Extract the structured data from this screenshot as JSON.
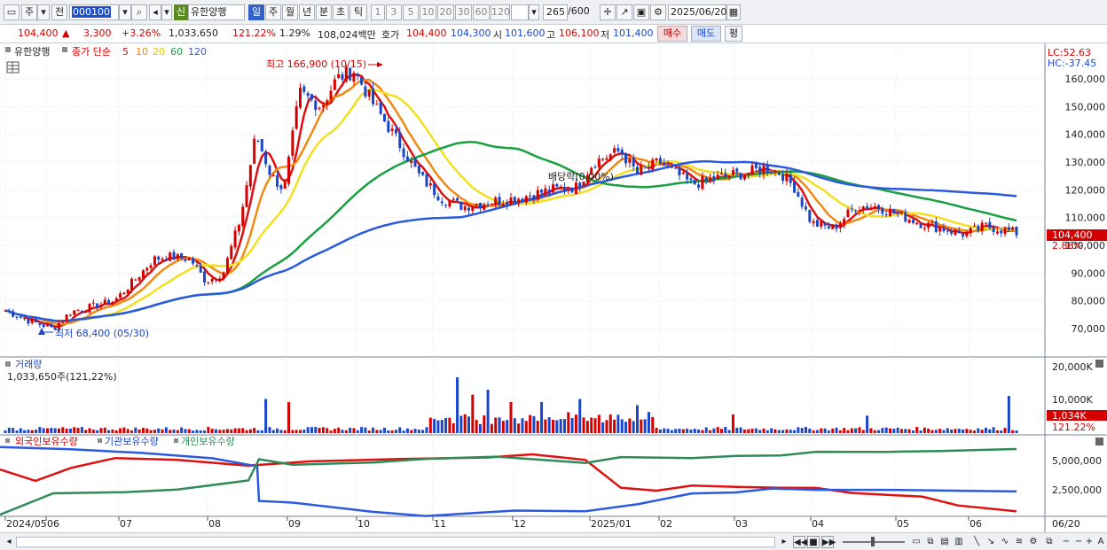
{
  "toolbar": {
    "period_label": "주",
    "prev_label": "전",
    "code_value": "000100",
    "credit_badge": "신",
    "stock_name": "유한양행",
    "timeframes": [
      "일",
      "주",
      "월",
      "년",
      "분",
      "초",
      "틱"
    ],
    "intervals": [
      "1",
      "3",
      "5",
      "10",
      "20",
      "30",
      "60",
      "120"
    ],
    "count_value": "265",
    "count_total": "/600",
    "date_value": "2025/06/20"
  },
  "quote": {
    "price": "104,400",
    "change_arrow": "▲",
    "change": "3,300",
    "change_pct": "+3.26%",
    "volume": "1,033,650",
    "volume_ratio": "121.22%",
    "turnover_pct": "1.29%",
    "trade_amount": "108,024백만",
    "bid_label": "호가",
    "ask_price": "104,400",
    "bid_price": "104,300",
    "open_label": "시",
    "open": "101,600",
    "high_label": "고",
    "high": "106,100",
    "low_label": "저",
    "low": "101,400",
    "buy_label": "매수",
    "sell_label": "매도",
    "eval_label": "평"
  },
  "price_panel": {
    "legend_stock": "유한양행",
    "legend_ma_title": "종가 단순",
    "ma_periods": [
      "5",
      "10",
      "20",
      "60",
      "120"
    ],
    "ma_colors": [
      "#e01010",
      "#f08a10",
      "#f0e020",
      "#18a040",
      "#2a5ae0"
    ],
    "lc_label": "LC:52.63",
    "hc_label": "HC:-37.45",
    "y_ticks": [
      "160,000",
      "150,000",
      "140,000",
      "130,000",
      "120,000",
      "110,000",
      "100,000",
      "90,000",
      "80,000",
      "70,000"
    ],
    "high_note": "최고 166,900 (10/15)",
    "low_note": "최저 68,400 (05/30)",
    "dividend_note": "배당락(0.00%)",
    "current_tag": "104,400",
    "current_pct": "2.86%"
  },
  "volume_panel": {
    "title": "거래량",
    "info": "1,033,650주(121,22%)",
    "y_ticks": [
      "20,000K",
      "10,000K"
    ],
    "current_tag": "1,034K",
    "current_pct": "121.22%"
  },
  "holding_panel": {
    "legend": [
      "외국인보유수량",
      "기관보유수량",
      "개인보유수량"
    ],
    "colors": [
      "#e01010",
      "#2a5ae0",
      "#2e8b57"
    ],
    "y_ticks": [
      "5,000,000",
      "2,500,000"
    ]
  },
  "x_axis": {
    "labels": [
      "2024/05",
      "06",
      "07",
      "08",
      "09",
      "10",
      "11",
      "12",
      "2025/01",
      "02",
      "03",
      "04",
      "05",
      "06"
    ],
    "right_label": "06/20"
  }
}
